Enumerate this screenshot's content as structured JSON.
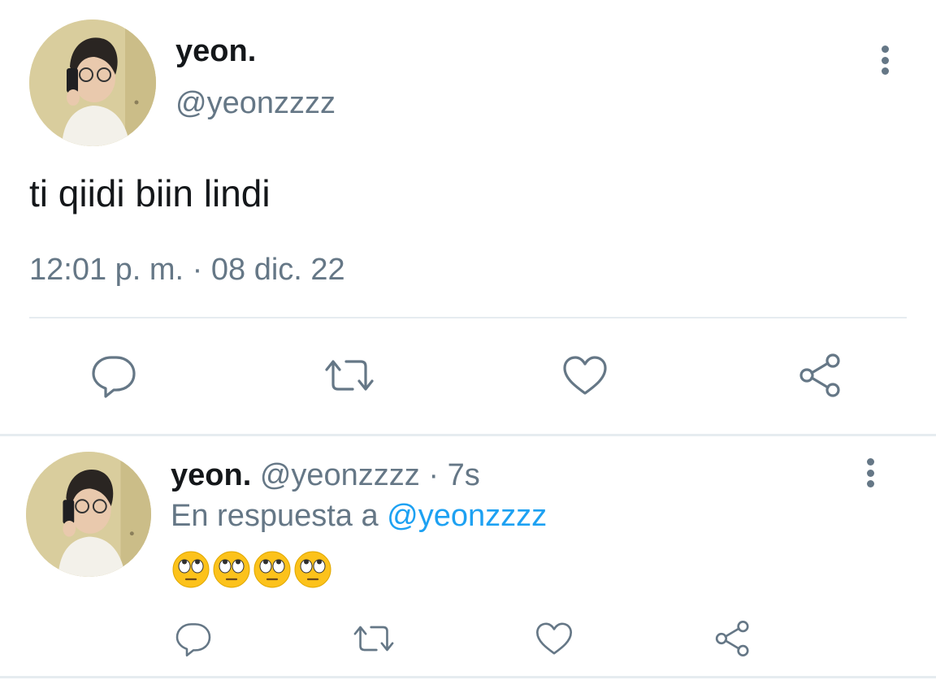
{
  "main_tweet": {
    "display_name": "yeon.",
    "handle": "@yeonzzzz",
    "text": "ti qiidi biin lindi",
    "timestamp": "12:01 p. m. · 08 dic. 22",
    "actions": [
      "reply",
      "retweet",
      "like",
      "share"
    ]
  },
  "reply_tweet": {
    "display_name": "yeon.",
    "handle": "@yeonzzzz",
    "age": "· 7s",
    "reply_prefix": "En respuesta a",
    "reply_to": "@yeonzzzz",
    "emoji_text": "🙄🙄🙄🙄",
    "actions": [
      "reply",
      "retweet",
      "like",
      "share"
    ]
  },
  "colors": {
    "text": "#14171a",
    "muted": "#657786",
    "link": "#1da1f2",
    "divider": "#e6ecf0"
  },
  "icons": [
    "more-vertical-icon",
    "reply-icon",
    "retweet-icon",
    "like-icon",
    "share-icon",
    "face-with-rolling-eyes-emoji"
  ]
}
